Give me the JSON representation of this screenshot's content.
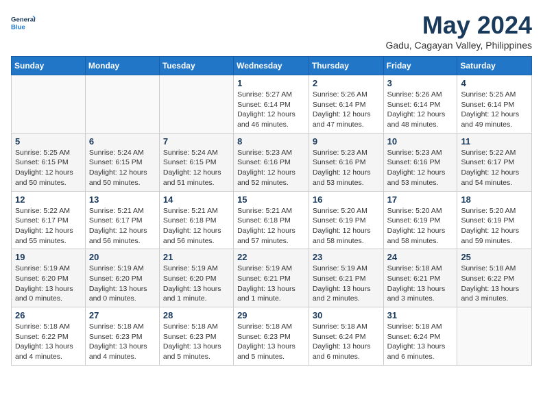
{
  "logo": {
    "line1": "General",
    "line2": "Blue"
  },
  "title": "May 2024",
  "subtitle": "Gadu, Cagayan Valley, Philippines",
  "days_of_week": [
    "Sunday",
    "Monday",
    "Tuesday",
    "Wednesday",
    "Thursday",
    "Friday",
    "Saturday"
  ],
  "weeks": [
    [
      {
        "day": "",
        "content": ""
      },
      {
        "day": "",
        "content": ""
      },
      {
        "day": "",
        "content": ""
      },
      {
        "day": "1",
        "content": "Sunrise: 5:27 AM\nSunset: 6:14 PM\nDaylight: 12 hours and 46 minutes."
      },
      {
        "day": "2",
        "content": "Sunrise: 5:26 AM\nSunset: 6:14 PM\nDaylight: 12 hours and 47 minutes."
      },
      {
        "day": "3",
        "content": "Sunrise: 5:26 AM\nSunset: 6:14 PM\nDaylight: 12 hours and 48 minutes."
      },
      {
        "day": "4",
        "content": "Sunrise: 5:25 AM\nSunset: 6:14 PM\nDaylight: 12 hours and 49 minutes."
      }
    ],
    [
      {
        "day": "5",
        "content": "Sunrise: 5:25 AM\nSunset: 6:15 PM\nDaylight: 12 hours and 50 minutes."
      },
      {
        "day": "6",
        "content": "Sunrise: 5:24 AM\nSunset: 6:15 PM\nDaylight: 12 hours and 50 minutes."
      },
      {
        "day": "7",
        "content": "Sunrise: 5:24 AM\nSunset: 6:15 PM\nDaylight: 12 hours and 51 minutes."
      },
      {
        "day": "8",
        "content": "Sunrise: 5:23 AM\nSunset: 6:16 PM\nDaylight: 12 hours and 52 minutes."
      },
      {
        "day": "9",
        "content": "Sunrise: 5:23 AM\nSunset: 6:16 PM\nDaylight: 12 hours and 53 minutes."
      },
      {
        "day": "10",
        "content": "Sunrise: 5:23 AM\nSunset: 6:16 PM\nDaylight: 12 hours and 53 minutes."
      },
      {
        "day": "11",
        "content": "Sunrise: 5:22 AM\nSunset: 6:17 PM\nDaylight: 12 hours and 54 minutes."
      }
    ],
    [
      {
        "day": "12",
        "content": "Sunrise: 5:22 AM\nSunset: 6:17 PM\nDaylight: 12 hours and 55 minutes."
      },
      {
        "day": "13",
        "content": "Sunrise: 5:21 AM\nSunset: 6:17 PM\nDaylight: 12 hours and 56 minutes."
      },
      {
        "day": "14",
        "content": "Sunrise: 5:21 AM\nSunset: 6:18 PM\nDaylight: 12 hours and 56 minutes."
      },
      {
        "day": "15",
        "content": "Sunrise: 5:21 AM\nSunset: 6:18 PM\nDaylight: 12 hours and 57 minutes."
      },
      {
        "day": "16",
        "content": "Sunrise: 5:20 AM\nSunset: 6:19 PM\nDaylight: 12 hours and 58 minutes."
      },
      {
        "day": "17",
        "content": "Sunrise: 5:20 AM\nSunset: 6:19 PM\nDaylight: 12 hours and 58 minutes."
      },
      {
        "day": "18",
        "content": "Sunrise: 5:20 AM\nSunset: 6:19 PM\nDaylight: 12 hours and 59 minutes."
      }
    ],
    [
      {
        "day": "19",
        "content": "Sunrise: 5:19 AM\nSunset: 6:20 PM\nDaylight: 13 hours and 0 minutes."
      },
      {
        "day": "20",
        "content": "Sunrise: 5:19 AM\nSunset: 6:20 PM\nDaylight: 13 hours and 0 minutes."
      },
      {
        "day": "21",
        "content": "Sunrise: 5:19 AM\nSunset: 6:20 PM\nDaylight: 13 hours and 1 minute."
      },
      {
        "day": "22",
        "content": "Sunrise: 5:19 AM\nSunset: 6:21 PM\nDaylight: 13 hours and 1 minute."
      },
      {
        "day": "23",
        "content": "Sunrise: 5:19 AM\nSunset: 6:21 PM\nDaylight: 13 hours and 2 minutes."
      },
      {
        "day": "24",
        "content": "Sunrise: 5:18 AM\nSunset: 6:21 PM\nDaylight: 13 hours and 3 minutes."
      },
      {
        "day": "25",
        "content": "Sunrise: 5:18 AM\nSunset: 6:22 PM\nDaylight: 13 hours and 3 minutes."
      }
    ],
    [
      {
        "day": "26",
        "content": "Sunrise: 5:18 AM\nSunset: 6:22 PM\nDaylight: 13 hours and 4 minutes."
      },
      {
        "day": "27",
        "content": "Sunrise: 5:18 AM\nSunset: 6:23 PM\nDaylight: 13 hours and 4 minutes."
      },
      {
        "day": "28",
        "content": "Sunrise: 5:18 AM\nSunset: 6:23 PM\nDaylight: 13 hours and 5 minutes."
      },
      {
        "day": "29",
        "content": "Sunrise: 5:18 AM\nSunset: 6:23 PM\nDaylight: 13 hours and 5 minutes."
      },
      {
        "day": "30",
        "content": "Sunrise: 5:18 AM\nSunset: 6:24 PM\nDaylight: 13 hours and 6 minutes."
      },
      {
        "day": "31",
        "content": "Sunrise: 5:18 AM\nSunset: 6:24 PM\nDaylight: 13 hours and 6 minutes."
      },
      {
        "day": "",
        "content": ""
      }
    ]
  ]
}
